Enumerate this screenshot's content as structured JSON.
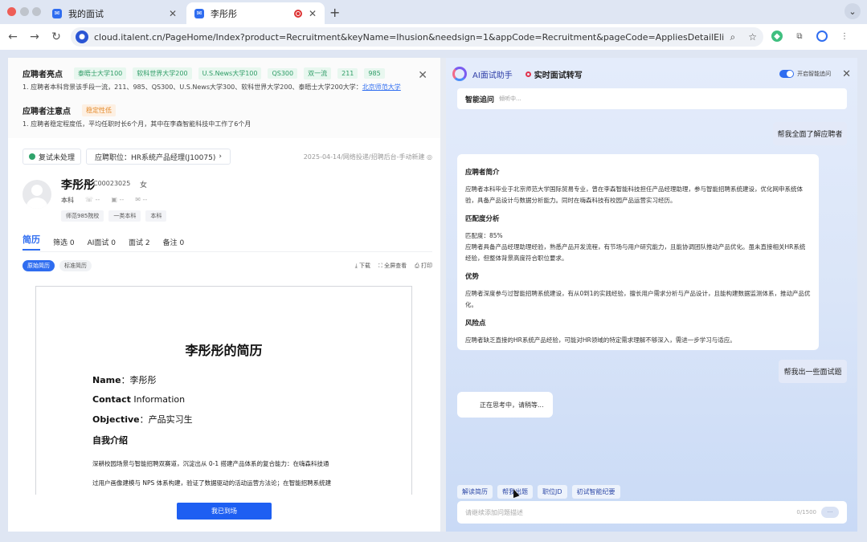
{
  "browser": {
    "tabs": [
      {
        "title": "我的面试",
        "active": false
      },
      {
        "title": "李彤彤",
        "active": true
      }
    ],
    "url": "cloud.italent.cn/PageHome/Index?product=Recruitment&keyName=Ihusion&needsign=1&appCode=Recruitment&pageCode=AppliesDetailElinkPage&applyId=5..."
  },
  "highlights": {
    "title": "应聘者亮点",
    "tags": [
      "泰晤士大学100",
      "软科世界大学200",
      "U.S.News大学100",
      "QS300",
      "双一流",
      "211",
      "985"
    ],
    "text_before": "1. 应聘者本科背景该手段一流，211、985、QS300、U.S.News大学300、软科世界大学200、泰晤士大学200大学：",
    "text_link": "北京师范大学",
    "notes_title": "应聘者注意点",
    "notes_tag": "稳定性低",
    "notes_text": "1. 应聘者稳定程度低，平均任职时长6个月，其中在李森智能科技中工作了6个月"
  },
  "job": {
    "status": "复试未处理",
    "position": "应聘职位：HR系统产品经理(J10075)",
    "position_arrow": "›",
    "meta": "2025-04-14/网络投递/招聘后台-手动新建 ◎"
  },
  "candidate": {
    "name": "李彤彤",
    "id": "C00023025",
    "gender": "女",
    "education": "本科",
    "phone": "--",
    "wechat": "--",
    "email": "--",
    "tags": [
      "师范985院校",
      "一类本科",
      "本科"
    ]
  },
  "tabs": [
    {
      "label": "简历",
      "active": true
    },
    {
      "label": "筛选 0",
      "active": false
    },
    {
      "label": "AI面试 0",
      "active": false
    },
    {
      "label": "面试 2",
      "active": false
    },
    {
      "label": "备注 0",
      "active": false
    }
  ],
  "subtabs": [
    {
      "label": "原始简历",
      "active": true
    },
    {
      "label": "标准简历",
      "active": false
    }
  ],
  "resume_actions": [
    "⤓ 下载",
    "⛶ 全屏查看",
    "⎙ 打印"
  ],
  "resume": {
    "title": "李彤彤的简历",
    "name_label": "Name",
    "name_value": "：李彤彤",
    "contact_label": "Contact",
    "contact_value": " Information",
    "objective_label": "Objective",
    "objective_value": "：产品实习生",
    "section": "自我介绍",
    "para_1": "深耕校园场景与智能招聘双赛道，沉淀出从 0-1 搭建产品体系的复合能力：在嗨森科技通",
    "para_2": "过用户画像建模与 NPS 体系构建，验证了数据驱动的活动运营方法论；在智能招聘系统建"
  },
  "primary_button": "我已到场",
  "assistant": {
    "title": "AI面试助手",
    "title_2": "实时面试转写",
    "toggle_label": "开启智能追问",
    "followup_label": "智能追问",
    "followup_status": "倾听中...",
    "user_msg_1": "帮我全面了解应聘者",
    "answer": [
      {
        "heading": "应聘者简介",
        "text": "应聘者本科毕业于北京师范大学国际贸易专业，曾在李森智能科技担任产品经理助理，参与智能招聘系统建设，优化网申系统体验，具备产品设计与数据分析能力。同时在嗨森科技有校园产品运营实习经历。"
      },
      {
        "heading": "匹配度分析",
        "text": "匹配度：85%\n应聘者具备产品经理助理经验，熟悉产品开发流程，有节场与用户研究能力，且能协调团队推动产品优化。虽未直接相关HR系统经验，但整体背景高度符合职位要求。"
      },
      {
        "heading": "优势",
        "text": "应聘者深度参与过智能招聘系统建设，有从0到1的实践经验，擅长用户需求分析与产品设计，且能构建数据监测体系，推动产品优化。"
      },
      {
        "heading": "风险点",
        "text": "应聘者缺乏直接的HR系统产品经验，可能对HR领域的特定需求理解不够深入，需进一步学习与适应。"
      }
    ],
    "user_msg_2": "帮我出一些面试题",
    "thinking": "正在思考中，请稍等...",
    "quick_actions": [
      "解读简历",
      "帮我出题",
      "职位JD",
      "初试智能纪要"
    ],
    "input_placeholder": "请继续添加问题描述",
    "counter": "0/1500",
    "send": "···"
  }
}
